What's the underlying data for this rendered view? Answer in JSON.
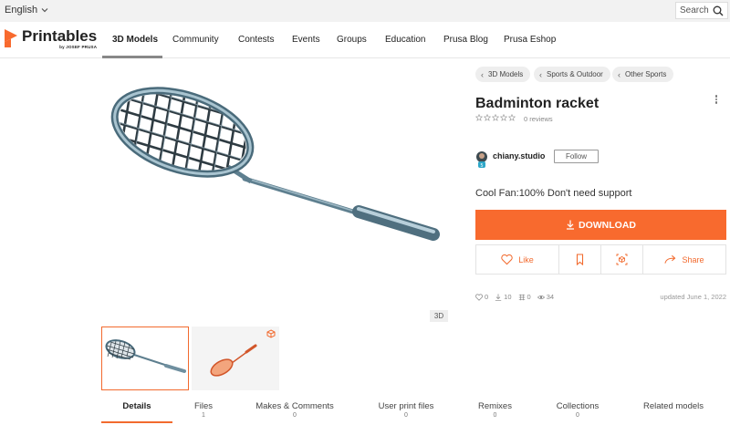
{
  "topbar": {
    "language": "English",
    "search_label": "Search"
  },
  "brand": {
    "name": "Printables",
    "sub": "by JOSEF PRUSA"
  },
  "nav": [
    "3D Models",
    "Community",
    "Contests",
    "Events",
    "Groups",
    "Education",
    "Prusa Blog",
    "Prusa Eshop"
  ],
  "breadcrumbs": [
    "3D Models",
    "Sports & Outdoor",
    "Other Sports"
  ],
  "model": {
    "title": "Badminton racket",
    "reviews": "0 reviews",
    "author": "chiany.studio",
    "follow_label": "Follow",
    "summary": "Cool Fan:100% Don't need support",
    "download_label": "DOWNLOAD",
    "like_label": "Like",
    "share_label": "Share",
    "likes": "0",
    "downloads": "10",
    "makes": "0",
    "views": "34",
    "updated": "updated June 1, 2022",
    "badge_3d": "3D"
  },
  "tabs": [
    {
      "label": "Details",
      "count": ""
    },
    {
      "label": "Files",
      "count": "1"
    },
    {
      "label": "Makes & Comments",
      "count": "0"
    },
    {
      "label": "User print files",
      "count": "0"
    },
    {
      "label": "Remixes",
      "count": "0"
    },
    {
      "label": "Collections",
      "count": "0"
    },
    {
      "label": "Related models",
      "count": ""
    }
  ],
  "colors": {
    "accent": "#f86a2e",
    "racket": "#6f93a4",
    "thumb_racket": "#e8693a"
  }
}
